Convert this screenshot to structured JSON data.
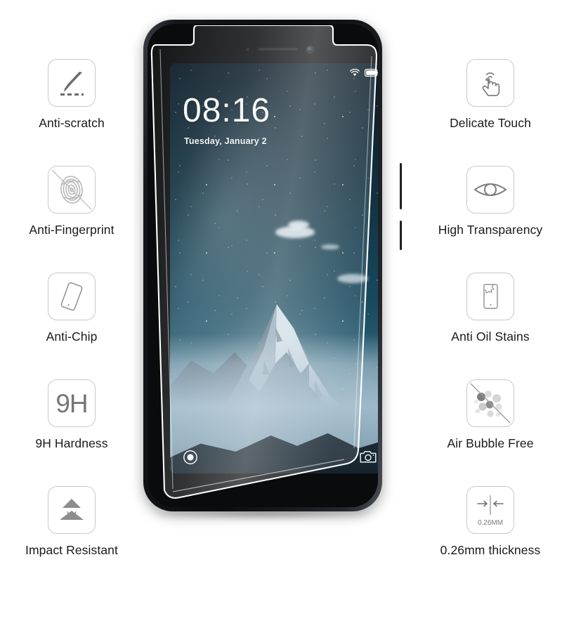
{
  "product": {
    "type": "tempered-glass-screen-protector-infographic",
    "background_color": "#ffffff",
    "icon_border_color": "#c9c9c9",
    "icon_glyph_color": "#6e6e6e",
    "label_color": "#1a1a1a"
  },
  "features_left": [
    {
      "id": "anti-scratch",
      "icon": "knife-scratch-icon",
      "label": "Anti-scratch"
    },
    {
      "id": "anti-fingerprint",
      "icon": "fingerprint-slash-icon",
      "label": "Anti-Fingerprint"
    },
    {
      "id": "anti-chip",
      "icon": "phone-tilted-icon",
      "label": "Anti-Chip"
    },
    {
      "id": "nine-h-hardness",
      "icon": "9h-text-icon",
      "label": "9H Hardness",
      "icon_text": "9H"
    },
    {
      "id": "impact-resistant",
      "icon": "layered-shield-icon",
      "label": "Impact Resistant"
    }
  ],
  "features_right": [
    {
      "id": "delicate-touch",
      "icon": "tapping-hand-icon",
      "label": "Delicate Touch"
    },
    {
      "id": "high-transparency",
      "icon": "eye-icon",
      "label": "High Transparency"
    },
    {
      "id": "anti-oil-stains",
      "icon": "phone-oil-stain-icon",
      "label": "Anti Oil Stains"
    },
    {
      "id": "air-bubble-free",
      "icon": "bubbles-slash-icon",
      "label": "Air Bubble Free"
    },
    {
      "id": "thickness",
      "icon": "thickness-arrows-icon",
      "label": "0.26mm thickness",
      "icon_text": "0.26MM"
    }
  ],
  "phone": {
    "device_color": "#0b0c0e",
    "screen": {
      "wallpaper": "starry-night-snow-mountain-above-clouds",
      "clock_time": "08:16",
      "clock_date": "Tuesday, January 2",
      "status_icons": [
        "wifi-icon",
        "battery-icon"
      ],
      "bottom_left_icon": "lock-ring-icon",
      "bottom_right_icon": "camera-icon"
    },
    "hardware": {
      "top_elements": [
        "earpiece-speaker",
        "front-camera",
        "proximity-sensor"
      ],
      "side_buttons": [
        "volume-rocker",
        "power-button"
      ]
    }
  },
  "glass_overlay": {
    "label": "tempered-glass-sheet",
    "edge_color": "#ffffff",
    "tint": "rgba(255,255,255,0.10)"
  }
}
